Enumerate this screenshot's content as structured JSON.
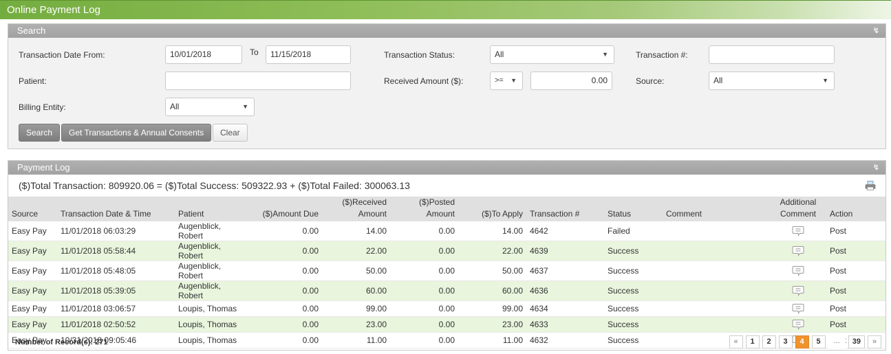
{
  "page": {
    "title": "Online Payment Log"
  },
  "search": {
    "header": "Search",
    "collapse_icon": "double-chevron-down-icon",
    "labels": {
      "date_from": "Transaction Date From:",
      "to": "To",
      "status": "Transaction Status:",
      "transaction_no": "Transaction #:",
      "patient": "Patient:",
      "received_amount": "Received Amount ($):",
      "source": "Source:",
      "billing_entity": "Billing Entity:"
    },
    "values": {
      "date_from": "10/01/2018",
      "date_to": "11/15/2018",
      "status": "All",
      "transaction_no": "",
      "patient": "",
      "amount_operator": ">=",
      "received_amount": "0.00",
      "source": "All",
      "billing_entity": "All"
    },
    "buttons": {
      "search": "Search",
      "get_transactions": "Get Transactions & Annual Consents",
      "clear": "Clear"
    }
  },
  "log": {
    "header": "Payment Log",
    "totals": "($)Total Transaction: 809920.06 = ($)Total Success: 509322.93 + ($)Total Failed: 300063.13",
    "columns": {
      "source": "Source",
      "datetime": "Transaction Date & Time",
      "patient": "Patient",
      "amount_due": "($)Amount Due",
      "received_1": "($)Received",
      "received_2": "Amount",
      "posted_1": "($)Posted",
      "posted_2": "Amount",
      "to_apply": "($)To Apply",
      "transaction_no": "Transaction #",
      "status": "Status",
      "comment": "Comment",
      "addl_1": "Additional",
      "addl_2": "Comment",
      "action": "Action"
    },
    "rows": [
      {
        "source": "Easy Pay",
        "datetime": "11/01/2018 06:03:29",
        "patient": "Augenblick, Robert",
        "amount_due": "0.00",
        "received": "14.00",
        "posted": "0.00",
        "to_apply": "14.00",
        "transaction_no": "4642",
        "status": "Failed",
        "comment": "",
        "action": "Post"
      },
      {
        "source": "Easy Pay",
        "datetime": "11/01/2018 05:58:44",
        "patient": "Augenblick, Robert",
        "amount_due": "0.00",
        "received": "22.00",
        "posted": "0.00",
        "to_apply": "22.00",
        "transaction_no": "4639",
        "status": "Success",
        "comment": "",
        "action": "Post"
      },
      {
        "source": "Easy Pay",
        "datetime": "11/01/2018 05:48:05",
        "patient": "Augenblick, Robert",
        "amount_due": "0.00",
        "received": "50.00",
        "posted": "0.00",
        "to_apply": "50.00",
        "transaction_no": "4637",
        "status": "Success",
        "comment": "",
        "action": "Post"
      },
      {
        "source": "Easy Pay",
        "datetime": "11/01/2018 05:39:05",
        "patient": "Augenblick, Robert",
        "amount_due": "0.00",
        "received": "60.00",
        "posted": "0.00",
        "to_apply": "60.00",
        "transaction_no": "4636",
        "status": "Success",
        "comment": "",
        "action": "Post"
      },
      {
        "source": "Easy Pay",
        "datetime": "11/01/2018 03:06:57",
        "patient": "Loupis, Thomas",
        "amount_due": "0.00",
        "received": "99.00",
        "posted": "0.00",
        "to_apply": "99.00",
        "transaction_no": "4634",
        "status": "Success",
        "comment": "",
        "action": "Post"
      },
      {
        "source": "Easy Pay",
        "datetime": "11/01/2018 02:50:52",
        "patient": "Loupis, Thomas",
        "amount_due": "0.00",
        "received": "23.00",
        "posted": "0.00",
        "to_apply": "23.00",
        "transaction_no": "4633",
        "status": "Success",
        "comment": "",
        "action": "Post"
      },
      {
        "source": "Easy Pay",
        "datetime": "10/31/2018 09:05:46",
        "patient": "Loupis, Thomas",
        "amount_due": "0.00",
        "received": "11.00",
        "posted": "0.00",
        "to_apply": "11.00",
        "transaction_no": "4632",
        "status": "Success",
        "comment": "",
        "action": "Post"
      }
    ],
    "records": "Number of Record(s): 271",
    "pagination": {
      "prev": "«",
      "pages": [
        "1",
        "2",
        "3",
        "4",
        "5"
      ],
      "current": "4",
      "ellipsis": "...",
      "last": "39",
      "next": "»"
    }
  },
  "colors": {
    "accent_green": "#74ad3f",
    "row_alt": "#e9f5dd",
    "active_page": "#f0932b"
  }
}
